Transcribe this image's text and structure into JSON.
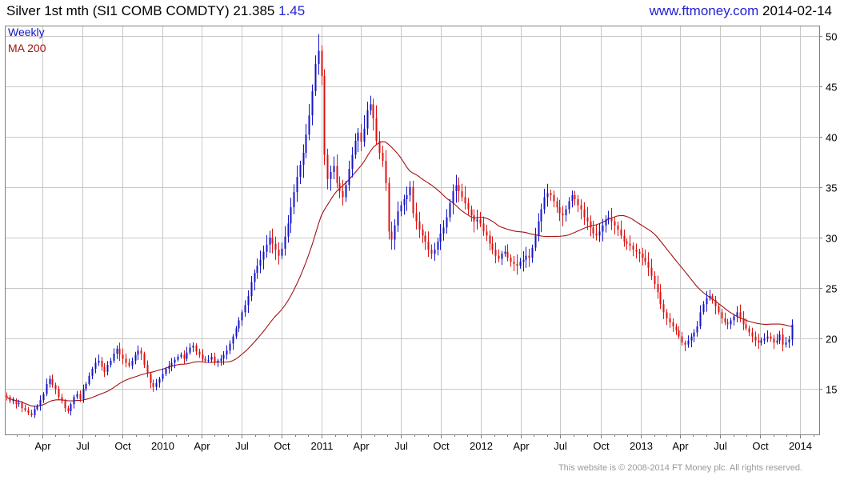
{
  "header": {
    "title": "Silver 1st mth (SI1 COMB COMDTY) 21.385",
    "change": "1.45",
    "site": "www.ftmoney.com",
    "date": "2014-02-14"
  },
  "legend": {
    "series1": "Weekly",
    "series2": "MA 200"
  },
  "footer": {
    "copyright": "This website is © 2008-2014 FT Money plc. All rights reserved."
  },
  "colors": {
    "up": "#1414c8",
    "down": "#e01010",
    "ma": "#a01414",
    "grid": "#c8c8c8",
    "border": "#808080",
    "text": "#000000"
  },
  "chart_data": {
    "type": "candlestick",
    "title": "Silver 1st mth (SI1 COMB COMDTY) 21.385 1.45",
    "frequency": "Weekly",
    "yaxis_side": "right",
    "ylim": [
      10.5,
      51
    ],
    "yticks": [
      15,
      20,
      25,
      30,
      35,
      40,
      45,
      50
    ],
    "xlabels": [
      "Apr",
      "Jul",
      "Oct",
      "2010",
      "Apr",
      "Jul",
      "Oct",
      "2011",
      "Apr",
      "Jul",
      "Oct",
      "2012",
      "Apr",
      "Jul",
      "Oct",
      "2013",
      "Apr",
      "Jul",
      "Oct",
      "2014"
    ],
    "x_domain": [
      "2009-01-05",
      "2014-02-14"
    ],
    "grid": true,
    "legend": "top-left",
    "series": [
      {
        "name": "Weekly",
        "kind": "ohlc_weekly",
        "last_close": 21.385,
        "start": "2009-01-09",
        "step_days": 7,
        "closes": [
          14.2,
          13.8,
          13.9,
          13.5,
          13.6,
          13.1,
          12.9,
          12.6,
          12.4,
          13.0,
          13.3,
          13.9,
          14.5,
          15.5,
          16.0,
          15.4,
          15.0,
          14.2,
          13.8,
          13.1,
          12.8,
          13.5,
          14.2,
          14.5,
          14.0,
          15.0,
          15.5,
          16.3,
          17.0,
          17.6,
          17.8,
          17.2,
          16.7,
          17.4,
          17.8,
          18.5,
          19.0,
          18.4,
          18.0,
          17.6,
          17.3,
          17.8,
          18.4,
          18.8,
          18.5,
          17.4,
          16.5,
          15.6,
          15.2,
          15.6,
          16.0,
          16.5,
          17.0,
          17.3,
          17.6,
          17.9,
          18.2,
          18.4,
          18.0,
          18.6,
          19.1,
          19.3,
          18.7,
          18.4,
          18.0,
          17.8,
          17.9,
          18.2,
          17.7,
          17.8,
          18.0,
          18.4,
          18.8,
          19.5,
          20.2,
          21.0,
          21.8,
          22.6,
          23.3,
          24.2,
          25.6,
          26.5,
          27.2,
          27.8,
          28.6,
          29.3,
          30.0,
          29.4,
          28.8,
          28.2,
          28.9,
          30.1,
          31.4,
          33.0,
          34.5,
          36.0,
          37.2,
          38.4,
          40.2,
          42.1,
          44.5,
          47.2,
          48.5,
          46.0,
          38.2,
          35.8,
          36.5,
          37.1,
          35.4,
          34.6,
          34.0,
          35.2,
          36.8,
          38.2,
          39.6,
          40.4,
          39.5,
          40.8,
          42.6,
          43.2,
          41.8,
          39.6,
          38.4,
          37.6,
          35.4,
          30.6,
          29.8,
          31.2,
          32.6,
          33.2,
          33.8,
          34.2,
          35.0,
          32.4,
          31.6,
          30.8,
          30.2,
          29.6,
          28.8,
          28.4,
          28.8,
          29.6,
          30.4,
          31.0,
          32.0,
          33.4,
          34.6,
          35.2,
          34.6,
          34.0,
          33.4,
          32.8,
          32.2,
          31.6,
          31.8,
          31.4,
          30.6,
          30.2,
          29.4,
          28.8,
          28.2,
          27.9,
          28.4,
          28.6,
          28.0,
          27.6,
          27.4,
          27.2,
          27.6,
          27.8,
          28.2,
          28.0,
          29.0,
          30.2,
          31.6,
          32.8,
          34.0,
          34.4,
          34.2,
          33.6,
          33.0,
          32.4,
          32.2,
          32.8,
          33.6,
          34.2,
          33.8,
          33.2,
          32.8,
          32.0,
          31.6,
          31.0,
          30.4,
          30.2,
          30.6,
          31.2,
          31.8,
          32.0,
          31.6,
          31.2,
          30.8,
          30.2,
          29.6,
          29.4,
          29.2,
          28.8,
          28.6,
          28.4,
          28.0,
          27.6,
          27.0,
          26.2,
          25.4,
          24.6,
          23.4,
          22.6,
          22.0,
          21.6,
          21.2,
          20.8,
          20.2,
          19.6,
          19.4,
          19.8,
          20.2,
          20.6,
          21.2,
          22.6,
          23.4,
          24.0,
          24.2,
          23.8,
          23.2,
          22.6,
          22.0,
          21.6,
          21.4,
          21.8,
          22.2,
          22.6,
          22.0,
          21.4,
          21.0,
          20.6,
          20.2,
          19.8,
          19.6,
          19.8,
          20.0,
          20.2,
          20.0,
          19.6,
          19.8,
          20.4,
          19.4,
          19.6,
          19.9,
          21.385
        ]
      },
      {
        "name": "MA 200",
        "kind": "moving_average",
        "window_days": 200
      }
    ]
  }
}
